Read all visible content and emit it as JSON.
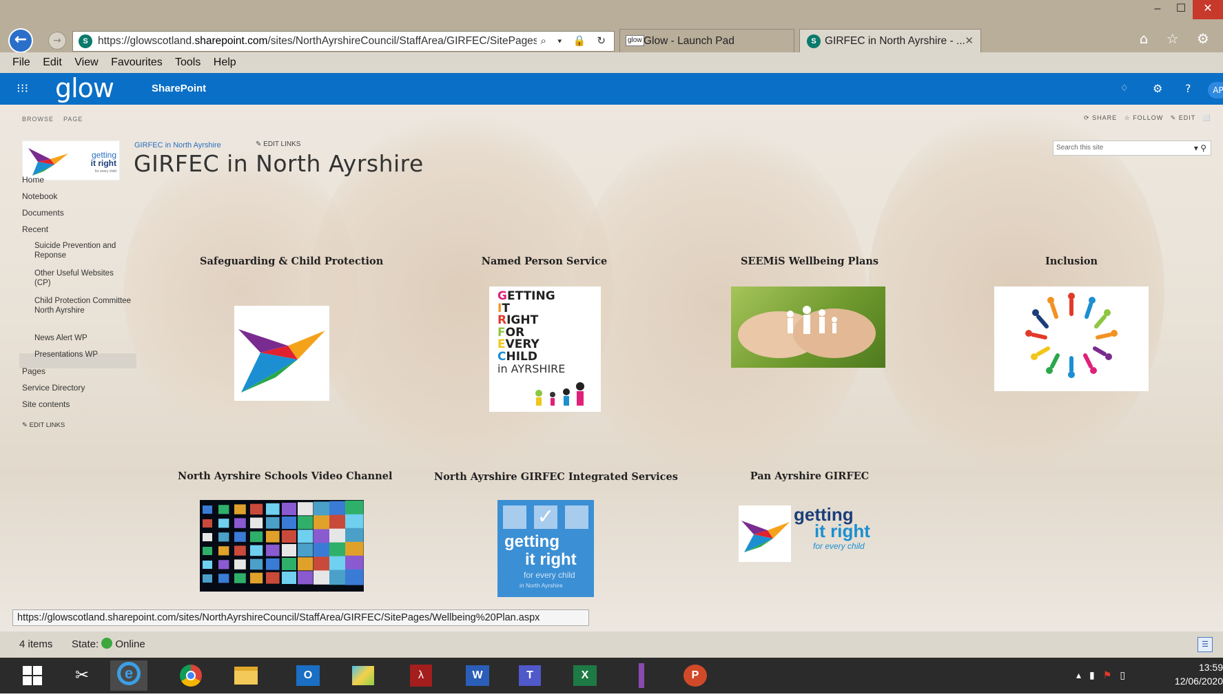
{
  "browser": {
    "url_prefix": "https://glowscotland.",
    "url_domain": "sharepoint.com",
    "url_rest": "/sites/NorthAyrshireCouncil/StaffArea/GIRFEC/SitePages/",
    "url_tail": "I",
    "address_icons": "⌕ ▾ 🔒 ↻",
    "tabs": [
      {
        "label": "Glow - Launch Pad",
        "favicon": "glow"
      },
      {
        "label": "GIRFEC in North Ayrshire - ...",
        "favicon": "S",
        "close": "✕"
      }
    ],
    "win_min": "–",
    "win_max": "☐",
    "win_close": "✕",
    "tools_icons": "⌂ ☆ ⚙",
    "menu": [
      "File",
      "Edit",
      "View",
      "Favourites",
      "Tools",
      "Help"
    ]
  },
  "suite": {
    "waffle": "⁝⁝⁝",
    "logo": "glow",
    "app": "SharePoint",
    "bell": "🔔",
    "gear": "⚙",
    "help": "?",
    "avatar": "AP"
  },
  "ribbon": {
    "browse": "BROWSE",
    "page": "PAGE",
    "share": "SHARE",
    "follow": "FOLLOW",
    "edit": "EDIT"
  },
  "site": {
    "logo_line1": "getting",
    "logo_line2": "it right",
    "logo_line3": "for every child",
    "breadcrumb": "GIRFEC in North Ayrshire",
    "edit_links": "EDIT LINKS",
    "title": "GIRFEC in North Ayrshire",
    "search_placeholder": "Search this site"
  },
  "nav": {
    "items": [
      "Home",
      "Notebook",
      "Documents",
      "Recent"
    ],
    "sub": [
      "Suicide Prevention and Reponse",
      "Other Useful Websites (CP)",
      "Child Protection Committee North Ayrshire",
      "News Alert WP",
      "Presentations WP"
    ],
    "bottom": [
      "Pages",
      "Service Directory",
      "Site contents"
    ],
    "edit_links": "EDIT LINKS"
  },
  "tiles": [
    {
      "title": "Safeguarding & Child Protection"
    },
    {
      "title": "Named Person Service",
      "letters": [
        "G",
        "I",
        "R",
        "F",
        "E",
        "C"
      ],
      "words": [
        "ETTING",
        "T",
        "IGHT",
        "OR",
        "VERY",
        "HILD"
      ],
      "tail": "in AYRSHIRE"
    },
    {
      "title": "SEEMiS Wellbeing Plans"
    },
    {
      "title": "Inclusion"
    },
    {
      "title": "North Ayrshire Schools Video Channel"
    },
    {
      "title": "North Ayrshire GIRFEC Integrated Services",
      "line1": "getting",
      "line2": "it right",
      "line3": "for every child",
      "line4": "in North Ayrshire"
    },
    {
      "title": "Pan Ayrshire GIRFEC",
      "line1": "getting",
      "line2": "it right",
      "line3": "for every child"
    }
  ],
  "status": {
    "hover_url": "https://glowscotland.sharepoint.com/sites/NorthAyrshireCouncil/StaffArea/GIRFEC/SitePages/Wellbeing%20Plan.aspx",
    "items": "4 items",
    "state_label": "State:",
    "state_value": "Online"
  },
  "taskbar": {
    "time": "13:59",
    "date": "12/06/2020"
  }
}
